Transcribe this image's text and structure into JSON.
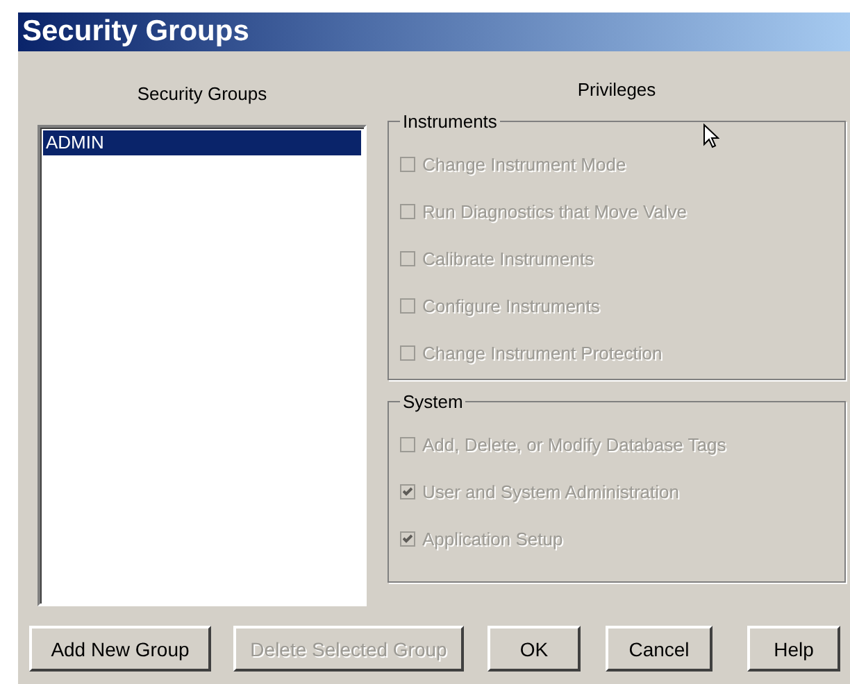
{
  "window": {
    "title": "Security Groups"
  },
  "groups_panel": {
    "heading": "Security Groups",
    "items": [
      {
        "label": "ADMIN",
        "selected": true
      }
    ]
  },
  "privileges_panel": {
    "heading": "Privileges",
    "sections": [
      {
        "title": "Instruments",
        "items": [
          {
            "label": "Change Instrument Mode",
            "checked": false,
            "disabled": true
          },
          {
            "label": "Run Diagnostics that Move Valve",
            "checked": false,
            "disabled": true
          },
          {
            "label": "Calibrate Instruments",
            "checked": false,
            "disabled": true
          },
          {
            "label": "Configure Instruments",
            "checked": false,
            "disabled": true
          },
          {
            "label": "Change Instrument Protection",
            "checked": false,
            "disabled": true
          }
        ]
      },
      {
        "title": "System",
        "items": [
          {
            "label": "Add, Delete, or Modify Database Tags",
            "checked": false,
            "disabled": true
          },
          {
            "label": "User and System Administration",
            "checked": true,
            "disabled": true
          },
          {
            "label": "Application Setup",
            "checked": true,
            "disabled": true
          }
        ]
      }
    ]
  },
  "buttons": [
    {
      "label": "Add New Group",
      "disabled": false
    },
    {
      "label": "Delete Selected Group",
      "disabled": true
    },
    {
      "label": "OK",
      "disabled": false
    },
    {
      "label": "Cancel",
      "disabled": false
    },
    {
      "label": "Help",
      "disabled": false
    }
  ]
}
